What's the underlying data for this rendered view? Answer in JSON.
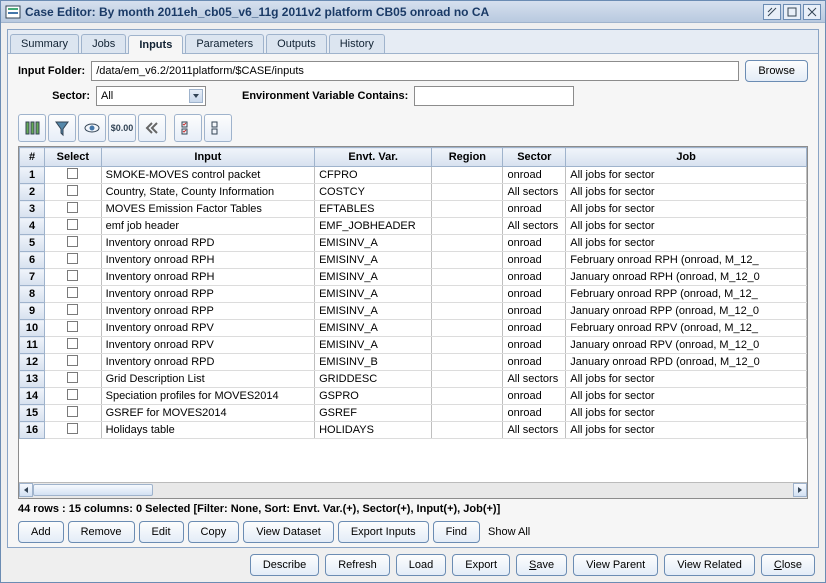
{
  "window": {
    "title": "Case Editor: By month 2011eh_cb05_v6_11g 2011v2 platform CB05 onroad no CA"
  },
  "tabs": [
    "Summary",
    "Jobs",
    "Inputs",
    "Parameters",
    "Outputs",
    "History"
  ],
  "active_tab": "Inputs",
  "form": {
    "input_folder_label": "Input Folder:",
    "input_folder_value": "/data/em_v6.2/2011platform/$CASE/inputs",
    "browse": "Browse",
    "sector_label": "Sector:",
    "sector_value": "All",
    "env_var_label": "Environment Variable Contains:",
    "env_var_value": ""
  },
  "toolbar_icons": [
    "tool-refresh",
    "tool-filter",
    "tool-view",
    "tool-cost",
    "tool-first",
    "tool-check-all",
    "tool-uncheck-all"
  ],
  "grid": {
    "headers": [
      "#",
      "Select",
      "Input",
      "Envt. Var.",
      "Region",
      "Sector",
      "Job"
    ],
    "rows": [
      {
        "n": "1",
        "input": "SMOKE-MOVES control packet",
        "env": "CFPRO",
        "reg": "",
        "sec": "onroad",
        "job": "All jobs for sector"
      },
      {
        "n": "2",
        "input": "Country, State, County Information",
        "env": "COSTCY",
        "reg": "",
        "sec": "All sectors",
        "job": "All jobs for sector"
      },
      {
        "n": "3",
        "input": "MOVES Emission Factor Tables",
        "env": "EFTABLES",
        "reg": "",
        "sec": "onroad",
        "job": "All jobs for sector"
      },
      {
        "n": "4",
        "input": "emf job header",
        "env": "EMF_JOBHEADER",
        "reg": "",
        "sec": "All sectors",
        "job": "All jobs for sector"
      },
      {
        "n": "5",
        "input": "Inventory onroad RPD",
        "env": "EMISINV_A",
        "reg": "",
        "sec": "onroad",
        "job": "All jobs for sector"
      },
      {
        "n": "6",
        "input": "Inventory onroad RPH",
        "env": "EMISINV_A",
        "reg": "",
        "sec": "onroad",
        "job": "February onroad RPH (onroad, M_12_"
      },
      {
        "n": "7",
        "input": "Inventory onroad RPH",
        "env": "EMISINV_A",
        "reg": "",
        "sec": "onroad",
        "job": "January onroad RPH (onroad, M_12_0"
      },
      {
        "n": "8",
        "input": "Inventory onroad RPP",
        "env": "EMISINV_A",
        "reg": "",
        "sec": "onroad",
        "job": "February onroad RPP (onroad, M_12_"
      },
      {
        "n": "9",
        "input": "Inventory onroad RPP",
        "env": "EMISINV_A",
        "reg": "",
        "sec": "onroad",
        "job": "January onroad RPP (onroad, M_12_0"
      },
      {
        "n": "10",
        "input": "Inventory onroad RPV",
        "env": "EMISINV_A",
        "reg": "",
        "sec": "onroad",
        "job": "February onroad RPV (onroad, M_12_"
      },
      {
        "n": "11",
        "input": "Inventory onroad RPV",
        "env": "EMISINV_A",
        "reg": "",
        "sec": "onroad",
        "job": "January onroad RPV (onroad, M_12_0"
      },
      {
        "n": "12",
        "input": "Inventory onroad RPD",
        "env": "EMISINV_B",
        "reg": "",
        "sec": "onroad",
        "job": "January onroad RPD (onroad, M_12_0"
      },
      {
        "n": "13",
        "input": "Grid Description List",
        "env": "GRIDDESC",
        "reg": "",
        "sec": "All sectors",
        "job": "All jobs for sector"
      },
      {
        "n": "14",
        "input": "Speciation profiles for MOVES2014",
        "env": "GSPRO",
        "reg": "",
        "sec": "onroad",
        "job": "All jobs for sector"
      },
      {
        "n": "15",
        "input": "GSREF for MOVES2014",
        "env": "GSREF",
        "reg": "",
        "sec": "onroad",
        "job": "All jobs for sector"
      },
      {
        "n": "16",
        "input": "Holidays table",
        "env": "HOLIDAYS",
        "reg": "",
        "sec": "All sectors",
        "job": "All jobs for sector"
      }
    ]
  },
  "status": "44 rows : 15 columns: 0 Selected [Filter: None, Sort: Envt. Var.(+), Sector(+), Input(+), Job(+)]",
  "row_buttons": {
    "add": "Add",
    "remove": "Remove",
    "edit": "Edit",
    "copy": "Copy",
    "view_dataset": "View Dataset",
    "export_inputs": "Export Inputs",
    "find": "Find",
    "show_all": "Show All"
  },
  "footer_buttons": {
    "describe": "Describe",
    "refresh": "Refresh",
    "load": "Load",
    "export": "Export",
    "save": "Save",
    "view_parent": "View Parent",
    "view_related": "View Related",
    "close": "Close"
  }
}
